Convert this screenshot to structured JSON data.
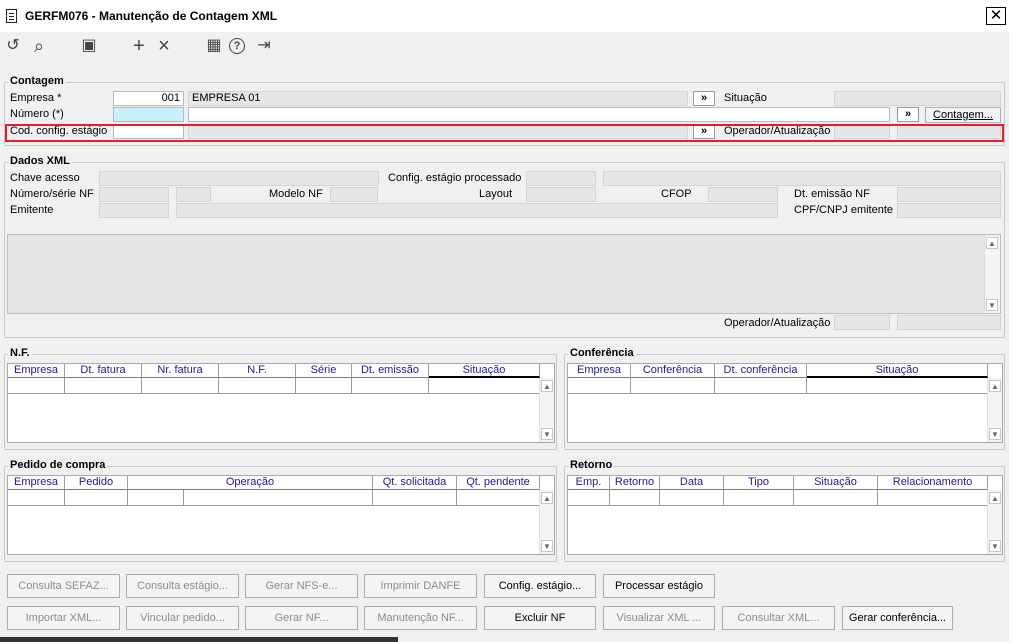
{
  "window": {
    "title": "GERFM076 - Manutenção de Contagem XML",
    "close": "✕"
  },
  "toolbar": {
    "undo": "↺",
    "search": "⌕",
    "save": "▣",
    "add": "+",
    "remove": "×",
    "calendar": "▦",
    "help": "?",
    "exit": "⇥"
  },
  "contagem": {
    "legend": "Contagem",
    "empresa_label": "Empresa *",
    "empresa_value": "001",
    "empresa_name": "EMPRESA 01",
    "numero_label": "Número (*)",
    "cod_config_label": "Cod. config. estágio",
    "situacao_label": "Situação",
    "operador_label": "Operador/Atualização",
    "contagem_button": "Contagem...",
    "lookup": "»"
  },
  "dados_xml": {
    "legend": "Dados XML",
    "chave_label": "Chave acesso",
    "config_processado_label": "Config. estágio processado",
    "numero_serie_label": "Número/série NF",
    "modelo_label": "Modelo NF",
    "layout_label": "Layout",
    "cfop_label": "CFOP",
    "dt_emissao_label": "Dt. emissão NF",
    "emitente_label": "Emitente",
    "cpf_cnpj_label": "CPF/CNPJ emitente",
    "operador_label": "Operador/Atualização"
  },
  "nf": {
    "legend": "N.F.",
    "columns": [
      "Empresa",
      "Dt. fatura",
      "Nr. fatura",
      "N.F.",
      "Série",
      "Dt. emissão",
      "Situação"
    ]
  },
  "conferencia": {
    "legend": "Conferência",
    "columns": [
      "Empresa",
      "Conferência",
      "Dt. conferência",
      "Situação"
    ]
  },
  "pedido": {
    "legend": "Pedido de compra",
    "columns": [
      "Empresa",
      "Pedido",
      "Operação",
      "Qt. solicitada",
      "Qt. pendente"
    ]
  },
  "retorno": {
    "legend": "Retorno",
    "columns": [
      "Emp.",
      "Retorno",
      "Data",
      "Tipo",
      "Situação",
      "Relacionamento"
    ]
  },
  "buttons_row1": [
    "Consulta SEFAZ...",
    "Consulta estágio...",
    "Gerar NFS-e...",
    "Imprimir DANFE",
    "Config. estágio...",
    "Processar estágio"
  ],
  "buttons_row2": [
    "Importar XML...",
    "Vincular pedido...",
    "Gerar NF...",
    "Manutenção NF...",
    "Excluir NF",
    "Visualizar XML ...",
    "Consultar XML...",
    "Gerar conferência..."
  ]
}
